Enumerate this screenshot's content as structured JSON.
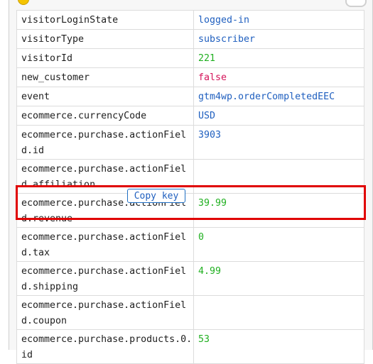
{
  "rows": [
    {
      "key": "visitorLoginState",
      "value": "logged-in",
      "type": "string"
    },
    {
      "key": "visitorType",
      "value": "subscriber",
      "type": "string"
    },
    {
      "key": "visitorId",
      "value": "221",
      "type": "number"
    },
    {
      "key": "new_customer",
      "value": "false",
      "type": "bool"
    },
    {
      "key": "event",
      "value": "gtm4wp.orderCompletedEEC",
      "type": "string"
    },
    {
      "key": "ecommerce.currencyCode",
      "value": "USD",
      "type": "string"
    },
    {
      "key": "ecommerce.purchase.actionField.id",
      "value": "3903",
      "type": "string"
    },
    {
      "key": "ecommerce.purchase.actionField.affiliation",
      "value": "",
      "type": "string"
    },
    {
      "key": "ecommerce.purchase.actionField.revenue",
      "value": "39.99",
      "type": "number"
    },
    {
      "key": "ecommerce.purchase.actionField.tax",
      "value": "0",
      "type": "number"
    },
    {
      "key": "ecommerce.purchase.actionField.shipping",
      "value": "4.99",
      "type": "number"
    },
    {
      "key": "ecommerce.purchase.actionField.coupon",
      "value": "",
      "type": "string"
    },
    {
      "key": "ecommerce.purchase.products.0.id",
      "value": "53",
      "type": "number"
    }
  ],
  "copy_key_button": {
    "label": "Copy key"
  },
  "colors": {
    "string": "#1f5fbf",
    "number": "#20b020",
    "bool": "#d4145a",
    "highlight": "#e00000"
  }
}
